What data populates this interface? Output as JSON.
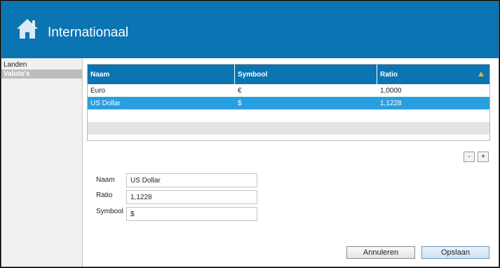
{
  "header": {
    "title": "Internationaal",
    "icon": "home-icon",
    "background": "#0b74b3"
  },
  "sidebar": {
    "items": [
      {
        "label": "Landen",
        "selected": false
      },
      {
        "label": "Valuta's",
        "selected": true
      }
    ]
  },
  "grid": {
    "columns": [
      "Naam",
      "Symbool",
      "Ratio"
    ],
    "sort": {
      "column": "Ratio",
      "direction": "ascending"
    },
    "rows": [
      {
        "naam": "Euro",
        "symbool": "€",
        "ratio": "1,0000",
        "selected": false
      },
      {
        "naam": "US Dollar",
        "symbool": "$",
        "ratio": "1,1228",
        "selected": true
      }
    ],
    "header_color": "#0b74b3",
    "selected_color": "#2a9fe0"
  },
  "row_buttons": {
    "remove": "-",
    "add": "+"
  },
  "form": {
    "naam": {
      "label": "Naam",
      "value": "US Dollar"
    },
    "ratio": {
      "label": "Ratio",
      "value": "1,1228"
    },
    "symbool": {
      "label": "Symbool",
      "value": "$"
    }
  },
  "actions": {
    "cancel": "Annuleren",
    "save": "Opslaan"
  }
}
